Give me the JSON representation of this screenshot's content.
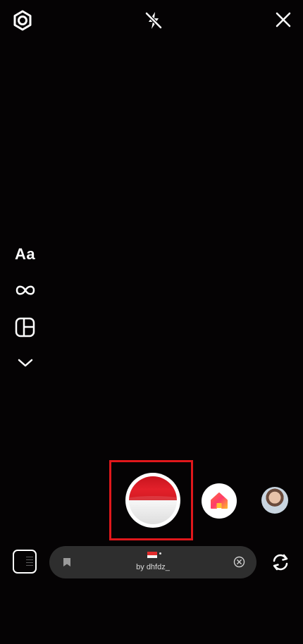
{
  "top_bar": {
    "settings_icon": "gear-icon",
    "flash_icon": "flash-off-icon",
    "close_icon": "close-icon"
  },
  "side_tools": {
    "create_label": "Aa",
    "boomerang_icon": "infinity-icon",
    "layout_icon": "layout-icon",
    "more_icon": "chevron-down-icon"
  },
  "capture": {
    "selected_effect_icon": "indonesia-flag-icon",
    "home_effect_icon": "home-icon",
    "profile_effect_icon": "avatar"
  },
  "effect_bar": {
    "creator_label": "by dhfdz_",
    "save_icon": "bookmark-icon",
    "remove_icon": "close-circle-icon"
  },
  "bottom": {
    "gallery_icon": "gallery-thumbnail",
    "flip_icon": "camera-flip-icon"
  },
  "colors": {
    "background": "#050304",
    "highlight": "#e0171b",
    "flag_red": "#d41a22",
    "effect_bar_bg": "#2e2e2e"
  }
}
